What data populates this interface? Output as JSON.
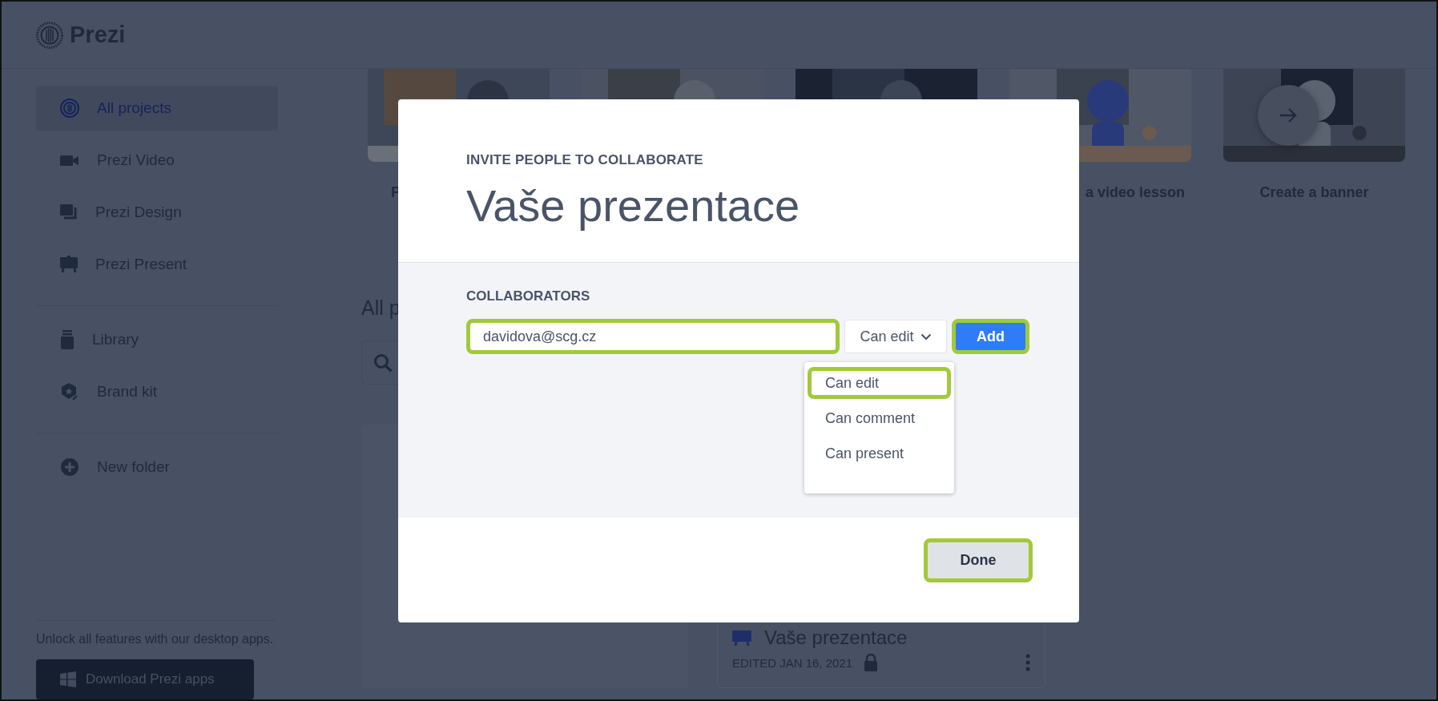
{
  "app": {
    "logo": "Prezi"
  },
  "sidebar": {
    "sections": [
      [
        {
          "label": "All projects",
          "selected": true
        },
        {
          "label": "Prezi Video",
          "selected": false
        },
        {
          "label": "Prezi Design",
          "selected": false
        },
        {
          "label": "Prezi Present",
          "selected": false
        }
      ],
      [
        {
          "label": "Library",
          "selected": false
        },
        {
          "label": "Brand kit",
          "selected": false
        }
      ],
      [
        {
          "label": "New folder",
          "selected": false
        }
      ]
    ],
    "promo": "Unlock all features with our desktop apps.",
    "download_button": "Download Prezi apps"
  },
  "templates": {
    "items": [
      {
        "label": "P",
        "kind": "picture"
      },
      {
        "kind": "picture"
      },
      {
        "kind": "picture"
      },
      {
        "label": "a video lesson",
        "kind": "picture"
      },
      {
        "label": "Create a banner",
        "kind": "picture"
      }
    ]
  },
  "projects": {
    "heading": "All p",
    "card": {
      "title": "Vaše prezentace",
      "meta": "EDITED JAN 16, 2021",
      "locked": true
    }
  },
  "dialog": {
    "eyebrow": "INVITE PEOPLE TO COLLABORATE",
    "title": "Vaše prezentace",
    "section_label": "COLLABORATORS",
    "email": {
      "value": "davidova@scg.cz",
      "highlighted": true
    },
    "permission": {
      "value": "Can edit",
      "expanded": true
    },
    "add_button": {
      "label": "Add",
      "highlighted": true
    },
    "options": [
      {
        "label": "Can edit",
        "highlighted": true
      },
      {
        "label": "Can comment",
        "highlighted": false
      },
      {
        "label": "Can present",
        "highlighted": false
      }
    ],
    "done_button": {
      "label": "Done",
      "highlighted": true
    }
  }
}
